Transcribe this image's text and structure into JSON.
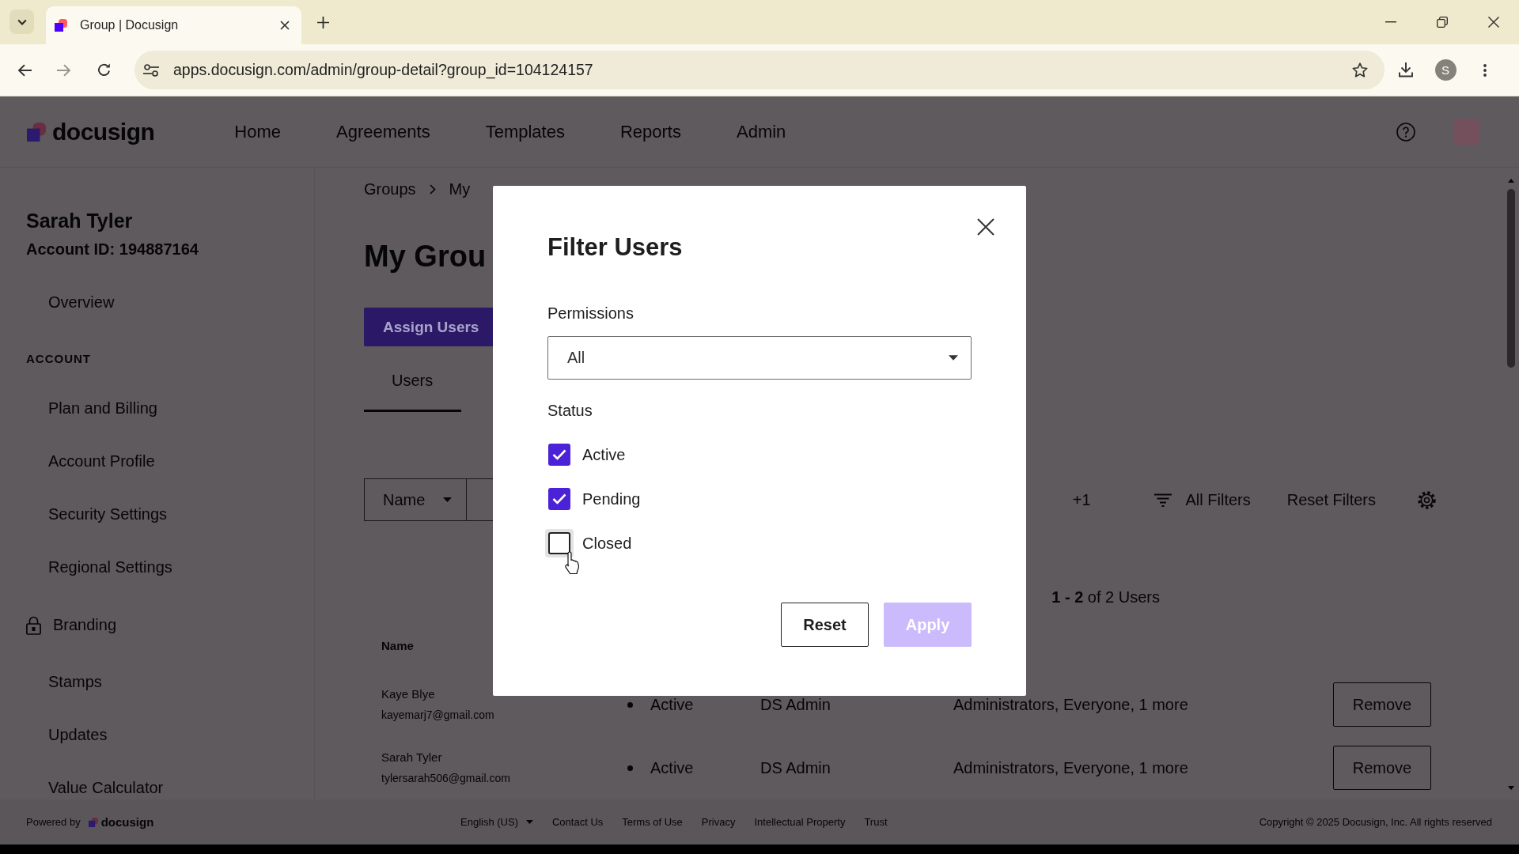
{
  "browser": {
    "tab_title": "Group | Docusign",
    "url": "apps.docusign.com/admin/group-detail?group_id=104124157",
    "profile_initial": "S"
  },
  "header": {
    "logo": "docusign",
    "nav": [
      "Home",
      "Agreements",
      "Templates",
      "Reports",
      "Admin"
    ]
  },
  "sidebar": {
    "user_name": "Sarah Tyler",
    "account_id": "Account ID: 194887164",
    "sections": [
      {
        "items": [
          {
            "label": "Overview",
            "locked": false
          }
        ]
      },
      {
        "heading": "ACCOUNT",
        "items": [
          {
            "label": "Plan and Billing",
            "locked": false
          },
          {
            "label": "Account Profile",
            "locked": false
          },
          {
            "label": "Security Settings",
            "locked": false
          },
          {
            "label": "Regional Settings",
            "locked": false
          },
          {
            "label": "Branding",
            "locked": true
          },
          {
            "label": "Stamps",
            "locked": false
          },
          {
            "label": "Updates",
            "locked": false
          },
          {
            "label": "Value Calculator",
            "locked": false
          }
        ]
      }
    ]
  },
  "main": {
    "breadcrumb": [
      "Groups",
      "My"
    ],
    "title": "My Grou",
    "assign_button": "Assign Users",
    "tabs": [
      {
        "label": "Users",
        "selected": true
      }
    ],
    "toolbar": {
      "search_by": "Name",
      "filter_count": "+1",
      "all_filters": "All Filters",
      "reset_filters": "Reset Filters"
    },
    "summary": "**1 - 2** of 2 Users",
    "table": {
      "columns": [
        "Name"
      ],
      "rows": [
        {
          "name": "Kaye Blye",
          "email": "kayemarj7@gmail.com",
          "status": "Active",
          "profile": "DS Admin",
          "groups": "Administrators, Everyone, 1 more",
          "action": "Remove"
        },
        {
          "name": "Sarah Tyler",
          "email": "tylersarah506@gmail.com",
          "status": "Active",
          "profile": "DS Admin",
          "groups": "Administrators, Everyone, 1 more",
          "action": "Remove"
        }
      ]
    }
  },
  "footer": {
    "powered_by": "Powered by",
    "logo": "docusign",
    "language": "English (US)",
    "links": [
      "Contact Us",
      "Terms of Use",
      "Privacy",
      "Intellectual Property",
      "Trust"
    ],
    "copyright": "Copyright © 2025 Docusign, Inc. All rights reserved"
  },
  "dialog": {
    "title": "Filter Users",
    "permissions": {
      "label": "Permissions",
      "value": "All"
    },
    "status": {
      "label": "Status",
      "options": [
        {
          "label": "Active",
          "checked": true,
          "hovered": false
        },
        {
          "label": "Pending",
          "checked": true,
          "hovered": false
        },
        {
          "label": "Closed",
          "checked": false,
          "hovered": true
        }
      ]
    },
    "buttons": [
      {
        "label": "Reset",
        "kind": "secondary",
        "disabled": false
      },
      {
        "label": "Apply",
        "kind": "primary",
        "disabled": true
      }
    ]
  }
}
